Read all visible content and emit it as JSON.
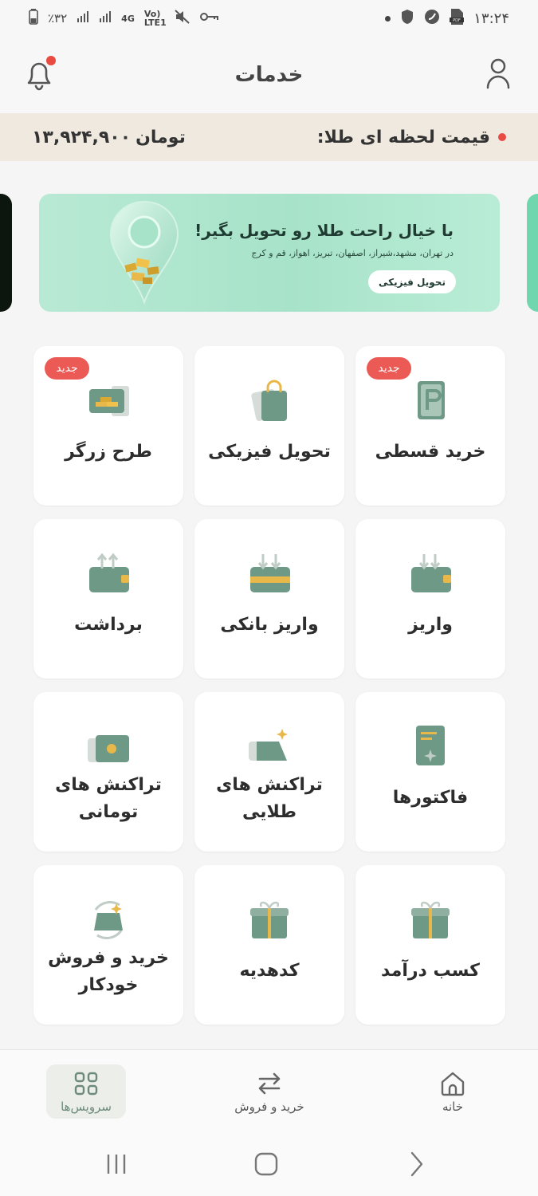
{
  "status_bar": {
    "battery": "٪۳۲",
    "network": "4G",
    "volte": "Vo) LTE1",
    "time": "۱۳:۲۴"
  },
  "header": {
    "title": "خدمات"
  },
  "price_bar": {
    "label": "قیمت لحظه ای طلا:",
    "value": "۱۳,۹۲۴,۹۰۰",
    "unit": "تومان"
  },
  "banner": {
    "title": "با خیال راحت طلا رو تحویل بگیر!",
    "subtitle": "در تهران، مشهد،شیراز، اصفهان، تبریز، اهواز، قم و کرج",
    "cta": "تحویل فیزیکی"
  },
  "services": [
    {
      "label": "خرید قسطی",
      "badge": "جدید",
      "icon": "installment-icon"
    },
    {
      "label": "تحویل فیزیکی",
      "badge": "",
      "icon": "shopping-bag-icon"
    },
    {
      "label": "طرح زرگر",
      "badge": "جدید",
      "icon": "gold-bars-icon"
    },
    {
      "label": "واریز",
      "badge": "",
      "icon": "wallet-deposit-icon"
    },
    {
      "label": "واریز بانکی",
      "badge": "",
      "icon": "bank-deposit-icon"
    },
    {
      "label": "برداشت",
      "badge": "",
      "icon": "wallet-withdraw-icon"
    },
    {
      "label": "فاکتورها",
      "badge": "",
      "icon": "invoice-icon"
    },
    {
      "label": "تراکنش های طلایی",
      "badge": "",
      "icon": "gold-transactions-icon"
    },
    {
      "label": "تراکنش های تومانی",
      "badge": "",
      "icon": "toman-transactions-icon"
    },
    {
      "label": "کسب درآمد",
      "badge": "",
      "icon": "gift-icon"
    },
    {
      "label": "کدهدیه",
      "badge": "",
      "icon": "gift-code-icon"
    },
    {
      "label": "خرید و فروش خودکار",
      "badge": "",
      "icon": "auto-trade-icon"
    }
  ],
  "bottom_nav": {
    "home": "خانه",
    "trade": "خرید و فروش",
    "services": "سرویس‌ها"
  },
  "colors": {
    "accent_green": "#6f9987",
    "gold": "#e8b84a",
    "badge_red": "#ec5a55"
  }
}
